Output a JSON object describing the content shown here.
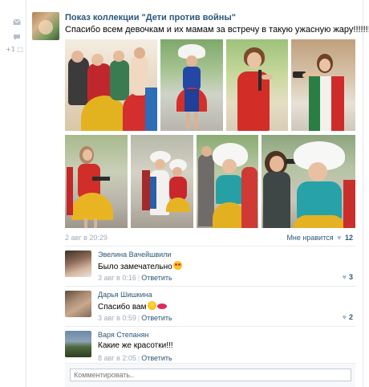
{
  "sidebar": {
    "mail_icon": "envelope-icon",
    "comment_icon": "comment-icon",
    "share_count": "+1"
  },
  "post": {
    "title": "Показ коллекции \"Дети против войны\"",
    "text": "Спасибо всем девочкам и их мамам за встречу в такую ужасную жару!!!!!!!!",
    "date": "2 авг в 20:29",
    "like_label": "Мне нравится",
    "like_count": "12",
    "photos": [
      {
        "scene": "group of girls in yellow and red skirts"
      },
      {
        "scene": "girl in blue dress with white headpiece"
      },
      {
        "scene": "girl in red dress aiming toy gun"
      },
      {
        "scene": "girl in green-white-red dress aiming gun"
      },
      {
        "scene": "girl in yellow skirt with gun"
      },
      {
        "scene": "girls walking in white and red dresses"
      },
      {
        "scene": "girl in teal top with white headpiece"
      },
      {
        "scene": "woman and girl with gun, white flower headpiece"
      }
    ]
  },
  "comments": [
    {
      "author": "Эвелина Вачейшвили",
      "text": "Было замечательно",
      "emoji": "heart-eyes",
      "date": "3 авг в 0:16",
      "reply_label": "Ответить",
      "likes": "3"
    },
    {
      "author": "Дарья Шишкина",
      "text": "Спасибо вам",
      "emoji": "kiss",
      "date": "3 авг в 0:59",
      "reply_label": "Ответить",
      "likes": "2"
    },
    {
      "author": "Варя Степанян",
      "text": "Какие же красотки!!!",
      "date": "8 авг в 2:05",
      "reply_label": "Ответить",
      "likes": ""
    }
  ],
  "compose": {
    "placeholder": "Комментировать.."
  },
  "colors": {
    "link": "#2b587a",
    "muted": "#a1acb7",
    "heart": "#a6b8cc"
  }
}
